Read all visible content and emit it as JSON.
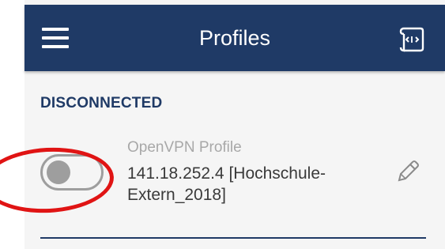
{
  "header": {
    "title": "Profiles",
    "menu_icon": "hamburger-menu-icon",
    "import_icon": "import-file-icon",
    "background_color": "#1f3a66"
  },
  "status": {
    "label": "DISCONNECTED"
  },
  "profile": {
    "type_label": "OpenVPN Profile",
    "server": "141.18.252.4 [Hochschule-Extern_2018]",
    "toggle_state": "off",
    "edit_icon": "pencil-icon"
  },
  "colors": {
    "accent": "#1f3a66",
    "annotation": "#e01414",
    "toggle_off": "#9e9e9e"
  }
}
